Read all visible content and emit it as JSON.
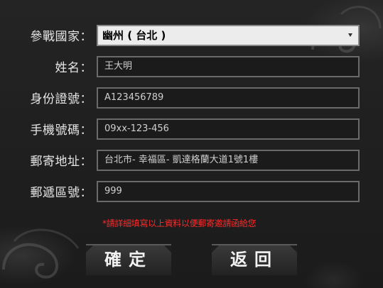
{
  "form": {
    "fields": [
      {
        "label": "參戰國家：",
        "value": "幽州 ( 台北 )"
      },
      {
        "label": "姓名：",
        "value": "王大明"
      },
      {
        "label": "身份證號：",
        "value": "A123456789"
      },
      {
        "label": "手機號碼：",
        "value": "09xx-123-456"
      },
      {
        "label": "郵寄地址：",
        "value": "台北市- 幸福區- 凱達格蘭大道1號1樓"
      },
      {
        "label": "郵遞區號：",
        "value": "999"
      }
    ],
    "notice": "*請詳細填寫以上資料以便郵寄邀請函給您",
    "confirm_label": "確定",
    "back_label": "返回"
  },
  "colors": {
    "notice": "#ff2a2a",
    "background": "#1e1e1e"
  }
}
